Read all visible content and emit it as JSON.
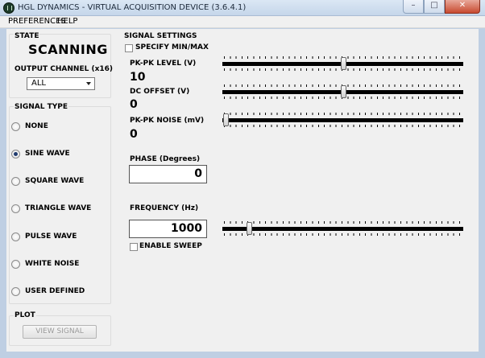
{
  "window": {
    "title": "HGL DYNAMICS - VIRTUAL ACQUISITION DEVICE (3.6.4.1)",
    "buttons": {
      "minimize": "–",
      "maximize": "□",
      "close": "✕"
    }
  },
  "menu": {
    "items": [
      "PREFERENCES",
      "HELP"
    ]
  },
  "state": {
    "label": "STATE",
    "value": "SCANNING"
  },
  "output_channel": {
    "label": "OUTPUT CHANNEL (x16)",
    "selected": "ALL"
  },
  "signal_type": {
    "label": "SIGNAL TYPE",
    "options": [
      "NONE",
      "SINE WAVE",
      "SQUARE WAVE",
      "TRIANGLE WAVE",
      "PULSE WAVE",
      "WHITE NOISE",
      "USER DEFINED"
    ],
    "selected": "SINE WAVE"
  },
  "plot": {
    "label": "PLOT",
    "view_button": "VIEW SIGNAL"
  },
  "signal_settings": {
    "label": "SIGNAL SETTINGS",
    "specify_minmax": {
      "label": "SPECIFY MIN/MAX",
      "checked": false
    },
    "pkpk_level": {
      "label": "PK-PK LEVEL (V)",
      "value": "10",
      "slider_fraction": 0.5
    },
    "dc_offset": {
      "label": "DC OFFSET (V)",
      "value": "0",
      "slider_fraction": 0.5
    },
    "pkpk_noise": {
      "label": "PK-PK NOISE (mV)",
      "value": "0",
      "slider_fraction": 0.0
    },
    "phase": {
      "label": "PHASE (Degrees)",
      "value": "0"
    },
    "frequency": {
      "label": "FREQUENCY (Hz)",
      "value": "1000",
      "slider_fraction": 0.1
    },
    "enable_sweep": {
      "label": "ENABLE SWEEP",
      "checked": false
    }
  }
}
